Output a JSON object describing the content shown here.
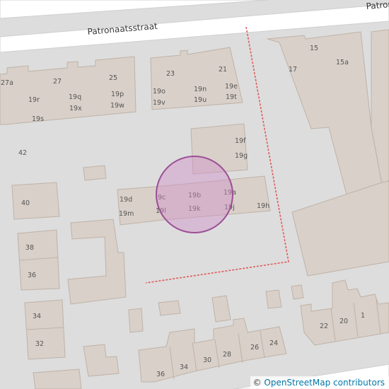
{
  "map": {
    "street_names": [
      "Patronaatsstraat",
      "Patrona"
    ],
    "house_numbers": [
      "27a",
      "27",
      "25",
      "19r",
      "19q",
      "19p",
      "19x",
      "19w",
      "19s",
      "23",
      "21",
      "19o",
      "19n",
      "19e",
      "19v",
      "19u",
      "19t",
      "15",
      "15a",
      "17",
      "19f",
      "19g",
      "42",
      "40",
      "19d",
      "9c",
      "19b",
      "19a",
      "19m",
      "19l",
      "19k",
      "19j",
      "19h",
      "38",
      "36",
      "34",
      "32",
      "30",
      "28",
      "26",
      "24",
      "22",
      "20",
      "1"
    ],
    "marker": {
      "fill": "#d090c8",
      "stroke": "#9b4f96"
    },
    "boundary_color": "#e05a5a",
    "building_fill": "#d9d0c9",
    "road_color": "#ffffff"
  },
  "attribution": {
    "copyright_symbol": "©",
    "link_text": "OpenStreetMap contributors"
  }
}
